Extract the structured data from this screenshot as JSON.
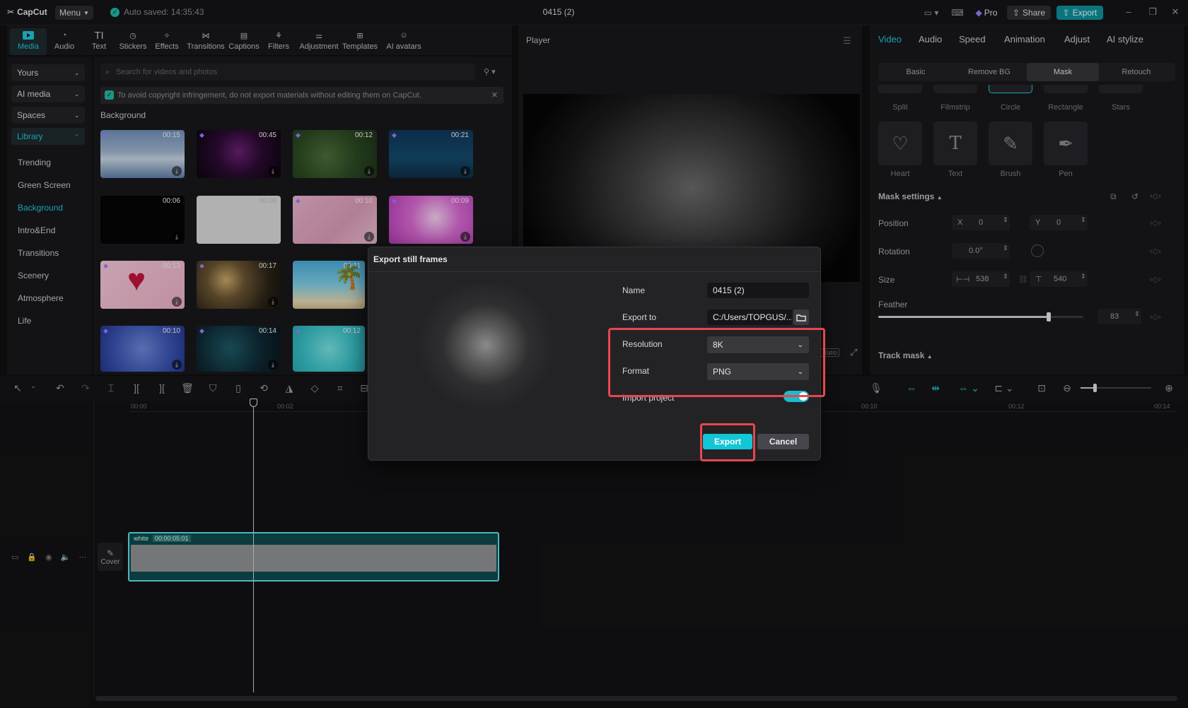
{
  "titlebar": {
    "logo": "CapCut",
    "menu": "Menu",
    "autosave": "Auto saved: 14:35:43",
    "project_title": "0415 (2)",
    "pro": "Pro",
    "share": "Share",
    "export": "Export"
  },
  "media_toolbar": {
    "items": [
      "Media",
      "Audio",
      "Text",
      "Stickers",
      "Effects",
      "Transitions",
      "Captions",
      "Filters",
      "Adjustment",
      "Templates",
      "AI avatars"
    ]
  },
  "left_nav": {
    "dropdowns": [
      "Yours",
      "AI media",
      "Spaces",
      "Library"
    ],
    "items": [
      "Trending",
      "Green Screen",
      "Background",
      "Intro&End",
      "Transitions",
      "Scenery",
      "Atmosphere",
      "Life"
    ]
  },
  "media": {
    "search_placeholder": "Search for videos and photos",
    "notice": "To avoid copyright infringement, do not export materials without editing them on CapCut.",
    "section_title": "Background",
    "thumbs": [
      {
        "duration": "00:15"
      },
      {
        "duration": "00:45"
      },
      {
        "duration": "00:12"
      },
      {
        "duration": "00:21"
      },
      {
        "duration": "00:06"
      },
      {
        "duration": "00:08"
      },
      {
        "duration": "00:10"
      },
      {
        "duration": "00:09"
      },
      {
        "duration": "00:13"
      },
      {
        "duration": "00:17"
      },
      {
        "duration": "00:11"
      },
      {
        "duration": "00:10"
      },
      {
        "duration": "00:14"
      },
      {
        "duration": "00:12"
      }
    ]
  },
  "player": {
    "title": "Player",
    "ratio": "Ratio"
  },
  "right_panel": {
    "tabs": [
      "Video",
      "Audio",
      "Speed",
      "Animation",
      "Adjust",
      "AI stylize"
    ],
    "subtabs": [
      "Basic",
      "Remove BG",
      "Mask",
      "Retouch"
    ],
    "mask_row1": [
      "Split",
      "Filmstrip",
      "Circle",
      "Rectangle",
      "Stars"
    ],
    "mask_row2": [
      "Heart",
      "Text",
      "Brush",
      "Pen"
    ],
    "mask_settings": "Mask settings",
    "position_label": "Position",
    "x_label": "X",
    "x_value": "0",
    "y_label": "Y",
    "y_value": "0",
    "rotation_label": "Rotation",
    "rotation_value": "0.0°",
    "size_label": "Size",
    "size_w": "538",
    "size_h": "540",
    "feather_label": "Feather",
    "feather_value": "83",
    "feather_level": 0.83,
    "track_mask": "Track mask"
  },
  "timeline": {
    "ruler": [
      "00:00",
      "00:02",
      "00:10",
      "00:12",
      "00:14"
    ],
    "clip_name": "white",
    "clip_duration": "00:00:05:01",
    "cover": "Cover"
  },
  "dialog": {
    "title": "Export still frames",
    "name_label": "Name",
    "name_value": "0415 (2)",
    "export_to_label": "Export to",
    "export_to_value": "C:/Users/TOPGUS/...",
    "resolution_label": "Resolution",
    "resolution_value": "8K",
    "format_label": "Format",
    "format_value": "PNG",
    "import_label": "Import project",
    "export_button": "Export",
    "cancel_button": "Cancel"
  },
  "colors": {
    "accent": "#22c5d8",
    "highlight": "#e8464f"
  }
}
